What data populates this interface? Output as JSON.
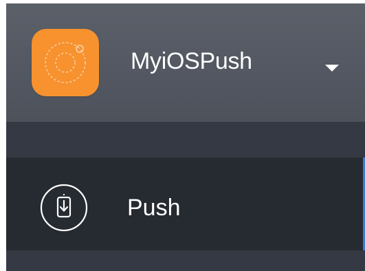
{
  "app": {
    "name": "MyiOSPush",
    "icon": "app-logo-icon",
    "icon_color": "#f7922f",
    "dropdown_icon": "caret-down-icon"
  },
  "nav": {
    "items": [
      {
        "label": "Push",
        "icon": "push-download-icon",
        "active": true
      }
    ]
  },
  "colors": {
    "header_bg": "#575c65",
    "panel_bg": "#353a44",
    "active_item_bg": "#262a31",
    "accent": "#3a7bd5",
    "text": "#ffffff"
  }
}
